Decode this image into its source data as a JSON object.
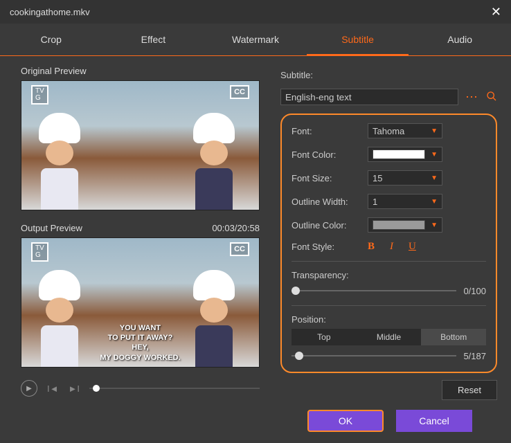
{
  "window": {
    "title": "cookingathome.mkv"
  },
  "tabs": [
    "Crop",
    "Effect",
    "Watermark",
    "Subtitle",
    "Audio"
  ],
  "active_tab": "Subtitle",
  "preview": {
    "original_label": "Original Preview",
    "output_label": "Output Preview",
    "timecode": "00:03/20:58",
    "badge_tvg": "TV\nG",
    "badge_cc": "CC",
    "subtitle_lines": [
      "YOU WANT",
      "TO PUT IT AWAY?",
      "HEY,",
      "MY DOGGY WORKED."
    ]
  },
  "subtitle_panel": {
    "subtitle_label": "Subtitle:",
    "subtitle_value": "English-eng text",
    "font_label": "Font:",
    "font_value": "Tahoma",
    "font_color_label": "Font Color:",
    "font_color_value": "#ffffff",
    "font_size_label": "Font Size:",
    "font_size_value": "15",
    "outline_width_label": "Outline Width:",
    "outline_width_value": "1",
    "outline_color_label": "Outline Color:",
    "outline_color_value": "#9a9a9a",
    "font_style_label": "Font Style:",
    "transparency_label": "Transparency:",
    "transparency_value": "0/100",
    "position_label": "Position:",
    "position_options": [
      "Top",
      "Middle",
      "Bottom"
    ],
    "position_active": "Bottom",
    "position_value": "5/187",
    "reset_label": "Reset"
  },
  "footer": {
    "ok": "OK",
    "cancel": "Cancel"
  }
}
